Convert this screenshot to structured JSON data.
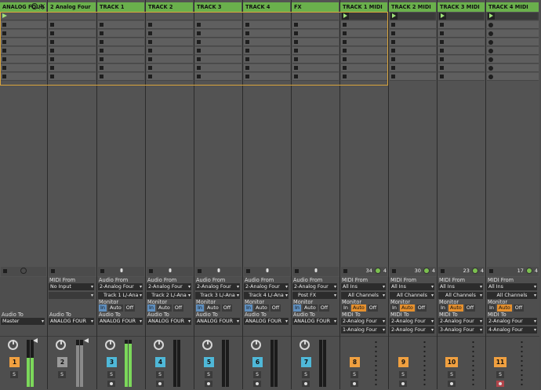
{
  "colors": {
    "accent_green": "#6ab04c",
    "clip_gold": "#d8a43c",
    "track_number": "#f0a040",
    "monitor_in": "#5f8fbf",
    "monitor_auto": "#e5902e"
  },
  "master": {
    "audio_to_label": "Audio To",
    "audio_to_value": "Master",
    "number": "1",
    "solo": "S"
  },
  "labels": {
    "midi_from": "MIDI From",
    "audio_from": "Audio From",
    "monitor": "Monitor",
    "audio_to": "Audio To",
    "midi_to": "MIDI To",
    "in": "In",
    "auto": "Auto",
    "off": "Off",
    "solo": "S"
  },
  "tracks": [
    {
      "title": "ANALOG FOUR",
      "number": "1"
    },
    {
      "title": "2 Analog Four",
      "number": "2",
      "midi_from": "No Input",
      "audio_to": "ANALOG FOUR"
    },
    {
      "title": "TRACK 1",
      "number": "3",
      "audio_from": "2-Analog Four",
      "audio_from_ch": "Track 1 L/-Ana",
      "audio_to": "ANALOG FOUR"
    },
    {
      "title": "TRACK 2",
      "number": "4",
      "audio_from": "2-Analog Four",
      "audio_from_ch": "Track 2 L/-Ana",
      "audio_to": "ANALOG FOUR"
    },
    {
      "title": "TRACK  3",
      "number": "5",
      "audio_from": "2-Analog Four",
      "audio_from_ch": "Track 3 L/-Ana",
      "audio_to": "ANALOG FOUR"
    },
    {
      "title": "TRACK 4",
      "number": "6",
      "audio_from": "2-Analog Four",
      "audio_from_ch": "Track 4 L/-Ana",
      "audio_to": "ANALOG FOUR"
    },
    {
      "title": "FX",
      "number": "7",
      "audio_from": "2-Analog Four",
      "audio_from_ch": "Post FX",
      "audio_to": "ANALOG FOUR"
    },
    {
      "title": "TRACK 1 MIDI",
      "number": "8",
      "badge_a": "34",
      "badge_b": "4",
      "midi_from": "All Ins",
      "midi_from_ch": "All Channels",
      "midi_to": "2-Analog Four",
      "midi_to_ch": "1-Analog Four"
    },
    {
      "title": "TRACK 2 MIDI",
      "number": "9",
      "badge_a": "30",
      "badge_b": "4",
      "midi_from": "All Ins",
      "midi_from_ch": "All Channels",
      "midi_to": "2-Analog Four",
      "midi_to_ch": "2-Analog Four"
    },
    {
      "title": "TRACK 3 MIDI",
      "number": "10",
      "badge_a": "23",
      "badge_b": "4",
      "midi_from": "All Ins",
      "midi_from_ch": "All Channels",
      "midi_to": "2-Analog Four",
      "midi_to_ch": "3-Analog Four"
    },
    {
      "title": "TRACK 4 MIDI",
      "number": "11",
      "badge_a": "17",
      "badge_b": "4",
      "midi_from": "All Ins",
      "midi_from_ch": "All Channels",
      "midi_to": "2-Analog Four",
      "midi_to_ch": "4-Analog Four"
    }
  ]
}
